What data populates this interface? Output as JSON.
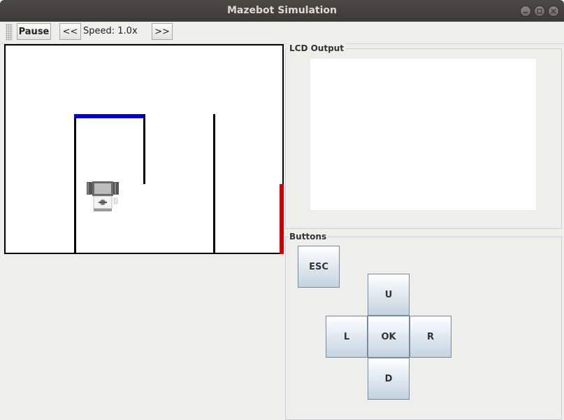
{
  "window": {
    "title": "Mazebot Simulation"
  },
  "toolbar": {
    "pause_label": "Pause",
    "slower_label": "<<",
    "speed_text": "Speed: 1.0x",
    "faster_label": ">>"
  },
  "lcd": {
    "title": "LCD Output"
  },
  "buttons": {
    "title": "Buttons",
    "esc": "ESC",
    "up": "U",
    "left": "L",
    "ok": "OK",
    "right": "R",
    "down": "D"
  },
  "colors": {
    "blue_wall": "#0000cc",
    "red_wall": "#cc0000"
  }
}
